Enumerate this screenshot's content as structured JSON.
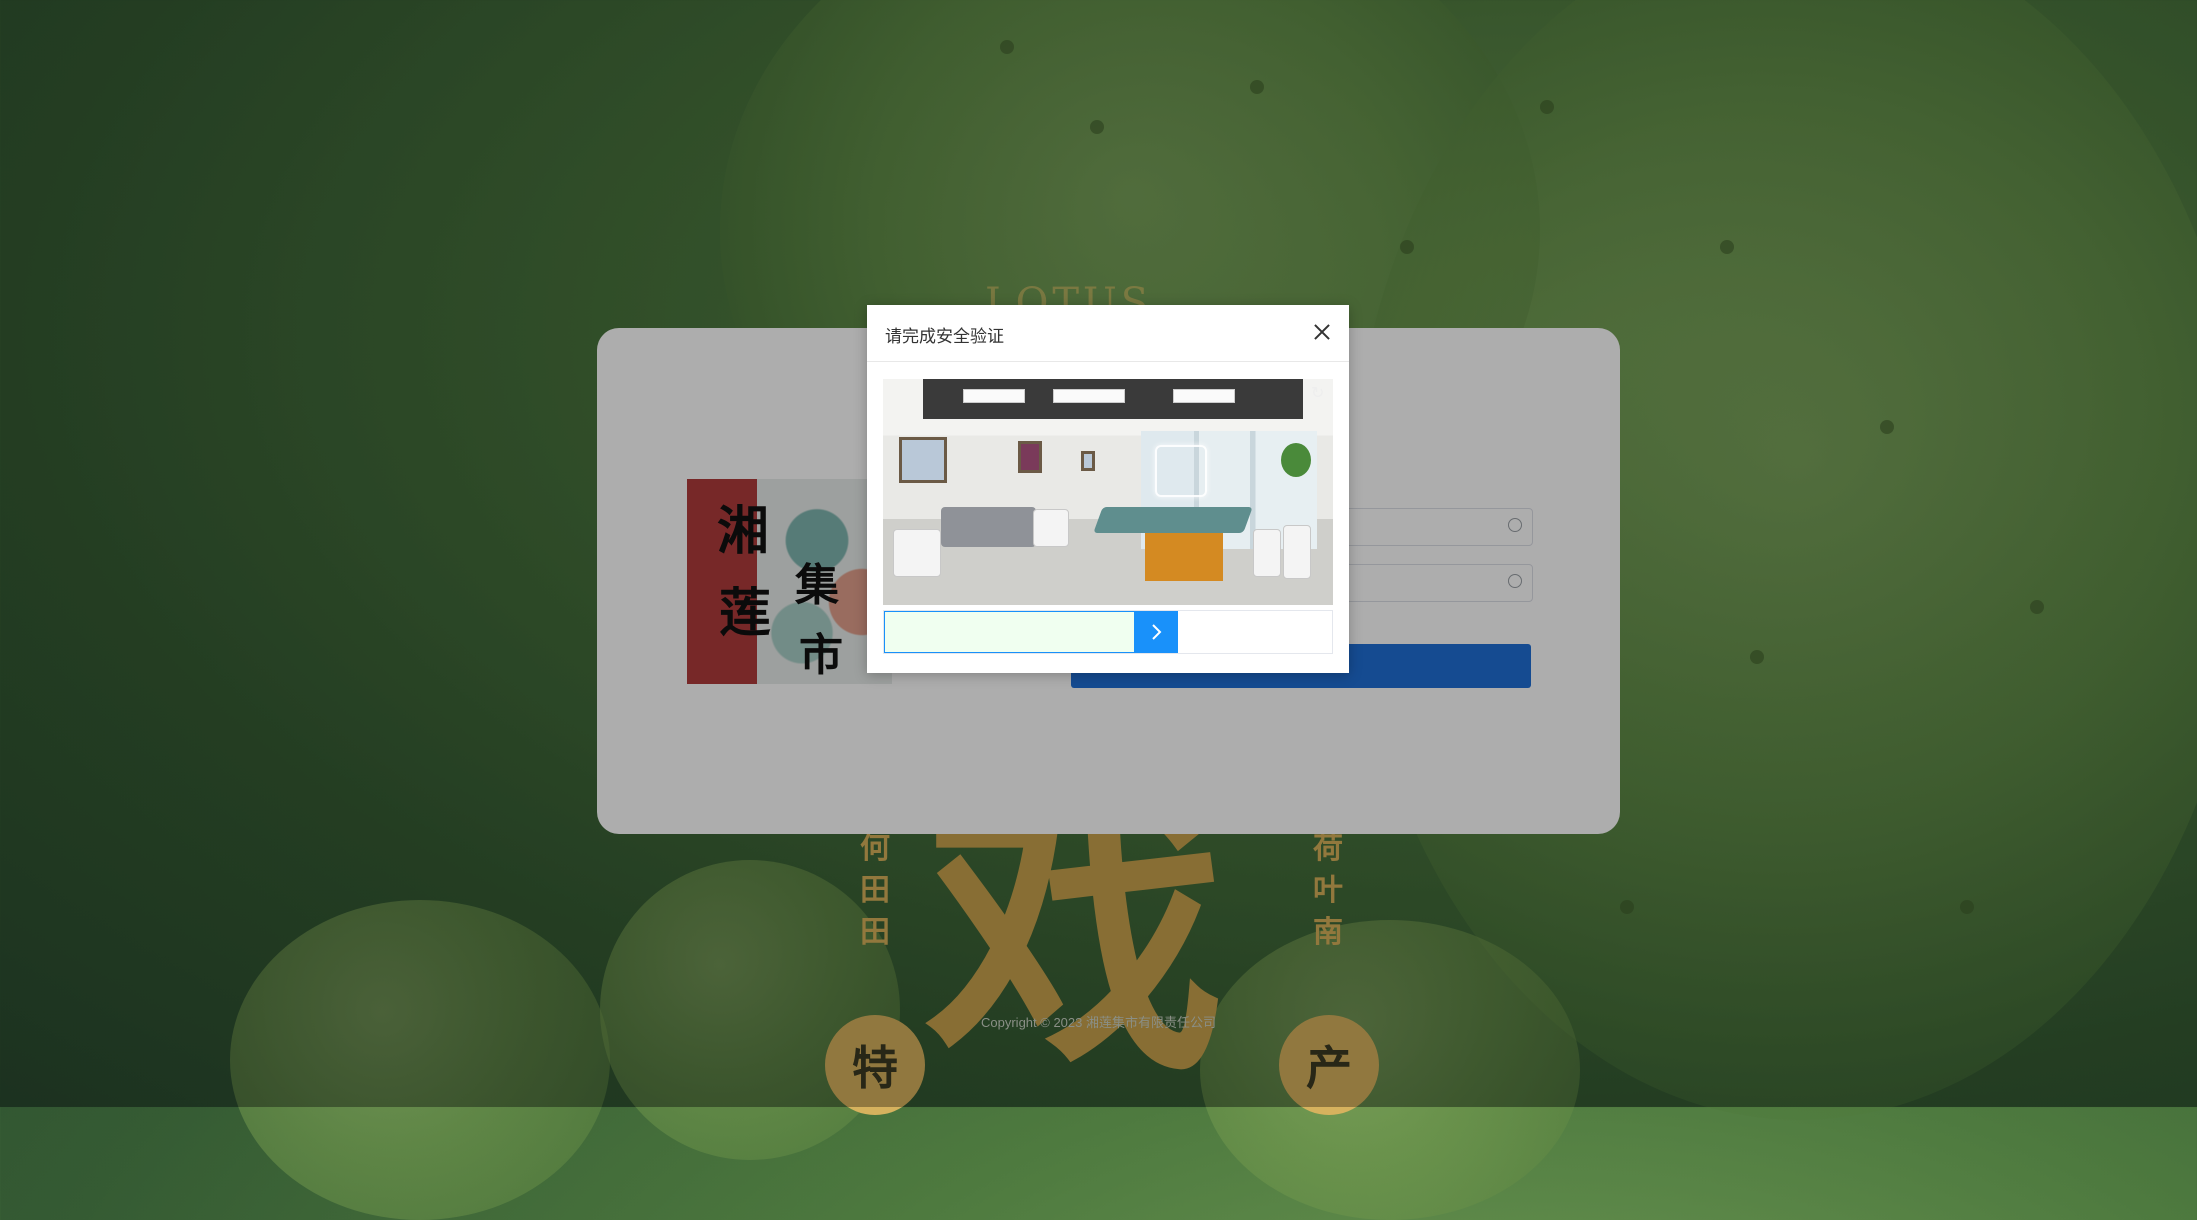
{
  "dialog": {
    "title": "请完成安全验证",
    "close_icon": "close-icon",
    "refresh_icon": "refresh-icon",
    "slider_icon": "chevron-right-icon",
    "slider_progress": 0.62,
    "accent_color": "#1991fa"
  },
  "poster": {
    "arc_text": "LOTUS",
    "left_vertical": [
      "何",
      "田",
      "田"
    ],
    "right_vertical": [
      "荷",
      "叶",
      "南"
    ],
    "big_glyph": "戏",
    "badge_left": "特",
    "badge_right": "产"
  },
  "promo": {
    "chars": [
      "湘",
      "莲",
      "集",
      "市"
    ]
  },
  "footer": {
    "copyright": "Copyright © 2023 湘莲集市有限责任公司"
  }
}
